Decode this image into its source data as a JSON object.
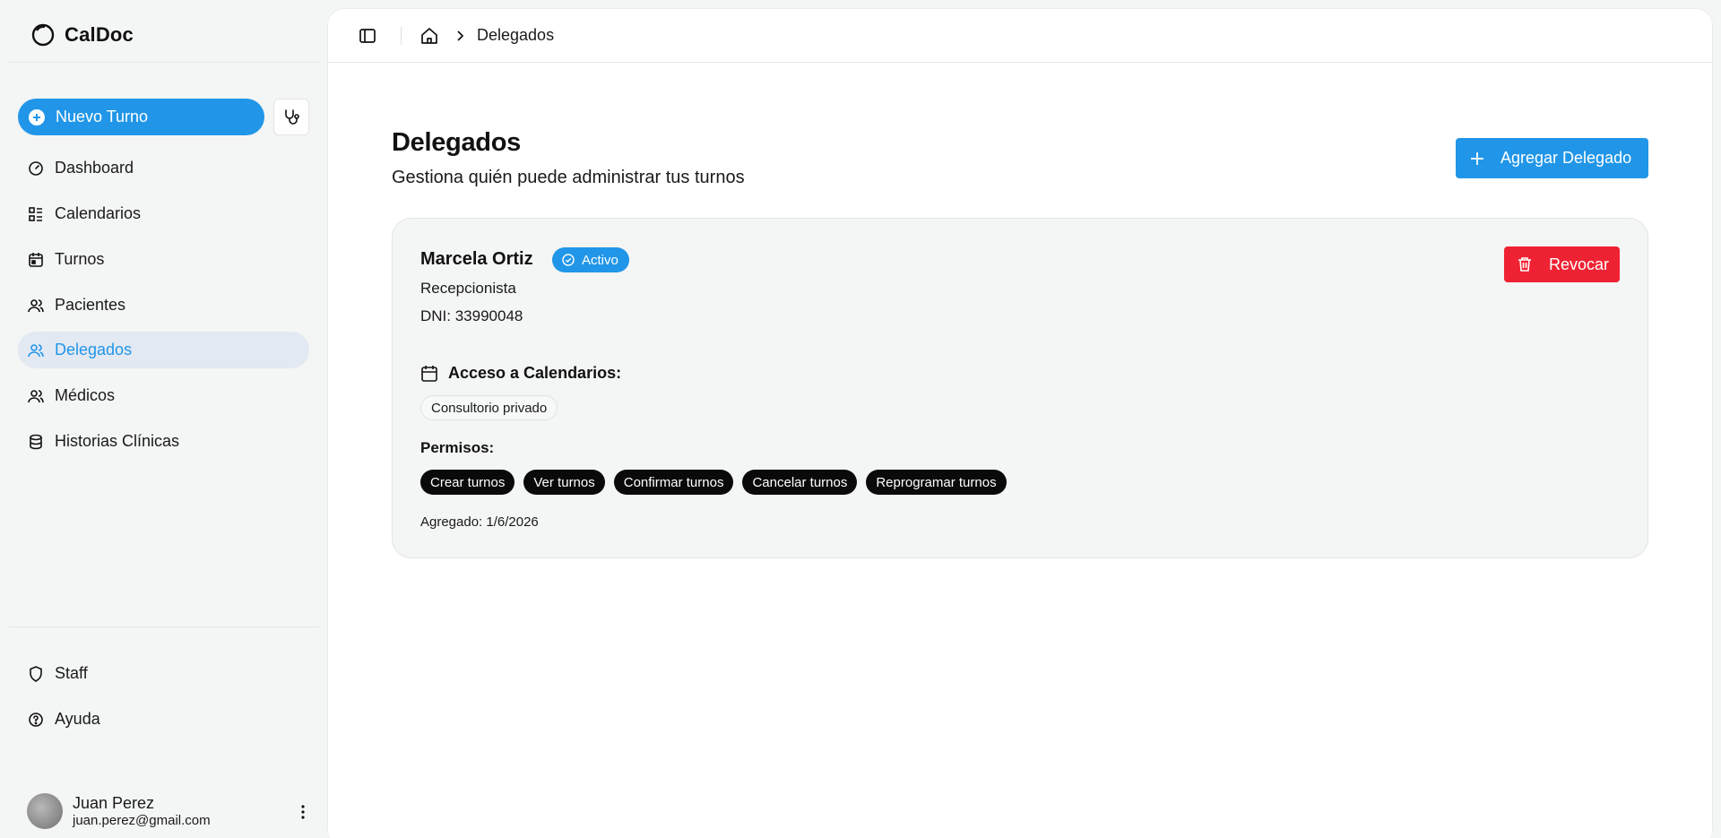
{
  "app": {
    "name": "CalDoc"
  },
  "sidebar": {
    "new_button_label": "Nuevo Turno",
    "items": [
      {
        "label": "Dashboard",
        "icon": "gauge-icon"
      },
      {
        "label": "Calendarios",
        "icon": "calendar-list-icon"
      },
      {
        "label": "Turnos",
        "icon": "calendar-icon"
      },
      {
        "label": "Pacientes",
        "icon": "users-icon"
      },
      {
        "label": "Delegados",
        "icon": "users-icon",
        "active": true
      },
      {
        "label": "Médicos",
        "icon": "users-icon"
      },
      {
        "label": "Historias Clínicas",
        "icon": "database-icon"
      }
    ],
    "footer_items": [
      {
        "label": "Staff",
        "icon": "shield-icon"
      },
      {
        "label": "Ayuda",
        "icon": "help-circle-icon"
      }
    ],
    "user": {
      "name": "Juan Perez",
      "email": "juan.perez@gmail.com"
    }
  },
  "breadcrumb": {
    "current": "Delegados"
  },
  "page": {
    "title": "Delegados",
    "subtitle": "Gestiona quién puede administrar tus turnos",
    "add_button_label": "Agregar Delegado"
  },
  "delegate": {
    "name": "Marcela Ortiz",
    "status": "Activo",
    "role": "Recepcionista",
    "dni": "DNI: 33990048",
    "revoke_label": "Revocar",
    "access_title": "Acceso a Calendarios:",
    "calendars": [
      "Consultorio privado"
    ],
    "permissions_title": "Permisos:",
    "permissions": [
      "Crear turnos",
      "Ver turnos",
      "Confirmar turnos",
      "Cancelar turnos",
      "Reprogramar turnos"
    ],
    "added": "Agregado: 1/6/2026"
  },
  "colors": {
    "accent": "#2196e8",
    "danger": "#ef2233",
    "active_bg": "#e3e9f3"
  }
}
